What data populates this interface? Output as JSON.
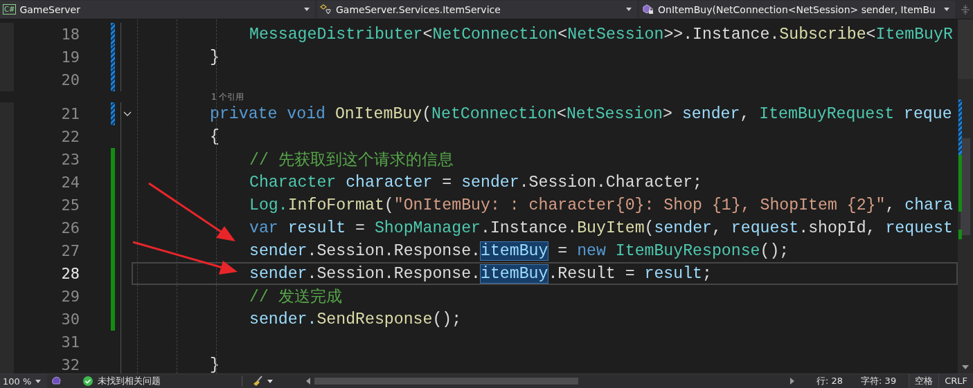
{
  "navigation_bar": {
    "project": {
      "label": "GameServer",
      "badge": "C#"
    },
    "class": {
      "label": "GameServer.Services.ItemService"
    },
    "member": {
      "label": "OnItemBuy(NetConnection<NetSession> sender, ItemBu"
    }
  },
  "editor": {
    "lines": [
      {
        "number": "18",
        "current": false,
        "reverted": true,
        "saved": false,
        "nested": true,
        "tokens": [
          {
            "text": "MessageDistributer",
            "kind": "type"
          },
          {
            "text": "<",
            "kind": "plain"
          },
          {
            "text": "NetConnection",
            "kind": "type"
          },
          {
            "text": "<",
            "kind": "plain"
          },
          {
            "text": "NetSession",
            "kind": "type"
          },
          {
            "text": ">>.Instance.",
            "kind": "plain"
          },
          {
            "text": "Subscribe",
            "kind": "method"
          },
          {
            "text": "<",
            "kind": "plain"
          },
          {
            "text": "ItemBuyR",
            "kind": "type"
          }
        ]
      },
      {
        "number": "19",
        "current": false,
        "reverted": true,
        "saved": false,
        "nested": false,
        "tokens": [
          {
            "text": "}",
            "kind": "plain"
          }
        ]
      },
      {
        "number": "20",
        "current": false,
        "reverted": true,
        "saved": false
      },
      {
        "number": "21",
        "current": false,
        "reverted": true,
        "saved": false,
        "expanded": true,
        "lens": "1 个引用",
        "nested": false,
        "tokens": [
          {
            "text": "private ",
            "kind": "keyword"
          },
          {
            "text": "void ",
            "kind": "keyword"
          },
          {
            "text": "OnItemBuy",
            "kind": "method"
          },
          {
            "text": "(",
            "kind": "plain"
          },
          {
            "text": "NetConnection",
            "kind": "type"
          },
          {
            "text": "<",
            "kind": "plain"
          },
          {
            "text": "NetSession",
            "kind": "type"
          },
          {
            "text": "> ",
            "kind": "plain"
          },
          {
            "text": "sender",
            "kind": "variable"
          },
          {
            "text": ", ",
            "kind": "plain"
          },
          {
            "text": "ItemBuyRequest ",
            "kind": "type"
          },
          {
            "text": "reque",
            "kind": "variable"
          }
        ]
      },
      {
        "number": "22",
        "current": false,
        "reverted": false,
        "saved": false,
        "nested": false,
        "tokens": [
          {
            "text": "{",
            "kind": "plain"
          }
        ]
      },
      {
        "number": "23",
        "current": false,
        "reverted": false,
        "saved": true,
        "nested": true,
        "tokens": [
          {
            "text": "// 先获取到这个请求的信息",
            "kind": "comment"
          }
        ]
      },
      {
        "number": "24",
        "current": false,
        "reverted": false,
        "saved": true,
        "nested": true,
        "tokens": [
          {
            "text": "Character ",
            "kind": "type"
          },
          {
            "text": "character",
            "kind": "variable"
          },
          {
            "text": " = ",
            "kind": "plain"
          },
          {
            "text": "sender",
            "kind": "variable"
          },
          {
            "text": ".Session.Character;",
            "kind": "plain"
          }
        ]
      },
      {
        "number": "25",
        "current": false,
        "reverted": false,
        "saved": true,
        "nested": true,
        "tokens": [
          {
            "text": "Log.",
            "kind": "type"
          },
          {
            "text": "InfoFormat",
            "kind": "method"
          },
          {
            "text": "(",
            "kind": "plain"
          },
          {
            "text": "\"OnItemBuy: : character{0}: Shop {1}, ShopItem {2}\"",
            "kind": "string"
          },
          {
            "text": ", ",
            "kind": "plain"
          },
          {
            "text": "chara",
            "kind": "variable"
          }
        ]
      },
      {
        "number": "26",
        "current": false,
        "reverted": false,
        "saved": true,
        "nested": true,
        "tokens": [
          {
            "text": "var ",
            "kind": "keyword"
          },
          {
            "text": "result",
            "kind": "variable"
          },
          {
            "text": " = ",
            "kind": "plain"
          },
          {
            "text": "ShopManager",
            "kind": "type"
          },
          {
            "text": ".Instance.",
            "kind": "plain"
          },
          {
            "text": "BuyItem",
            "kind": "method"
          },
          {
            "text": "(",
            "kind": "plain"
          },
          {
            "text": "sender",
            "kind": "variable"
          },
          {
            "text": ", ",
            "kind": "plain"
          },
          {
            "text": "request",
            "kind": "variable"
          },
          {
            "text": ".shopId, ",
            "kind": "plain"
          },
          {
            "text": "request",
            "kind": "variable"
          }
        ]
      },
      {
        "number": "27",
        "current": false,
        "reverted": false,
        "saved": true,
        "nested": true,
        "tokens": [
          {
            "text": "sender",
            "kind": "variable"
          },
          {
            "text": ".Session.Response.",
            "kind": "plain"
          },
          {
            "text": "itemBuy",
            "kind": "highlight"
          },
          {
            "text": " = ",
            "kind": "plain"
          },
          {
            "text": "new ",
            "kind": "keyword"
          },
          {
            "text": "ItemBuyResponse",
            "kind": "type"
          },
          {
            "text": "();",
            "kind": "plain"
          }
        ]
      },
      {
        "number": "28",
        "current": true,
        "reverted": false,
        "saved": true,
        "nested": true,
        "tokens": [
          {
            "text": "sender",
            "kind": "variable"
          },
          {
            "text": ".Session.Response.",
            "kind": "plain"
          },
          {
            "text": "itemBuy",
            "kind": "highlight"
          },
          {
            "text": ".Result = ",
            "kind": "plain"
          },
          {
            "text": "result",
            "kind": "variable"
          },
          {
            "text": ";",
            "kind": "plain"
          }
        ]
      },
      {
        "number": "29",
        "current": false,
        "reverted": false,
        "saved": true,
        "nested": true,
        "tokens": [
          {
            "text": "// 发送完成",
            "kind": "comment"
          }
        ]
      },
      {
        "number": "30",
        "current": false,
        "reverted": false,
        "saved": true,
        "nested": true,
        "tokens": [
          {
            "text": "sender.",
            "kind": "variable"
          },
          {
            "text": "SendResponse",
            "kind": "method"
          },
          {
            "text": "();",
            "kind": "plain"
          }
        ]
      },
      {
        "number": "31",
        "current": false,
        "reverted": false,
        "saved": false
      },
      {
        "number": "32",
        "current": false,
        "reverted": false,
        "saved": false,
        "nested": false,
        "tokens": [
          {
            "text": "}",
            "kind": "plain"
          }
        ]
      }
    ]
  },
  "status_bar": {
    "zoom": "100 %",
    "issues": "未找到相关问题",
    "line": "行: 28",
    "column": "字符: 39",
    "indentation": "空格",
    "line_ending": "CRLF"
  }
}
